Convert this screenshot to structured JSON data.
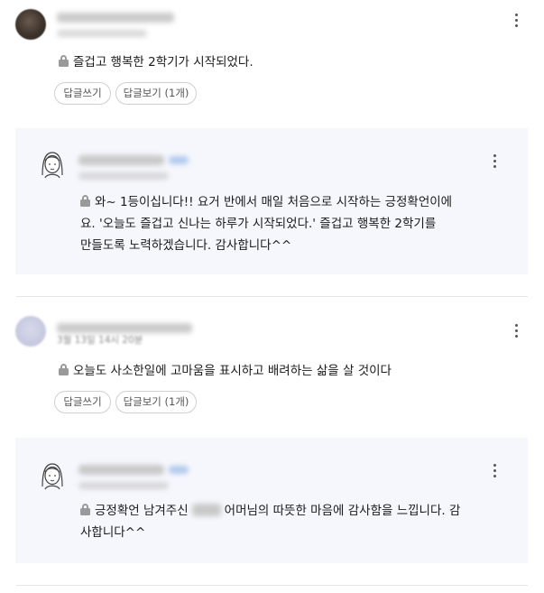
{
  "comment1": {
    "text": "즐겁고 행복한 2학기가 시작되었다.",
    "buttons": {
      "write_reply": "답글쓰기",
      "view_replies": "답글보기 (1개)"
    }
  },
  "reply1": {
    "line1": "와~ 1등이십니다!! 요거 반에서 매일 처음으로 시작하는 긍정확언이에",
    "line2": "요. '오늘도 즐겁고 신나는 하루가 시작되었다.' 즐겁고 행복한 2학기를",
    "line3": "만들도록 노력하겠습니다. 감사합니다^^"
  },
  "comment2": {
    "meta_partial": "3월 13일 14시 20분",
    "text": "오늘도 사소한일에 고마움을 표시하고 배려하는 삶을 살 것이다",
    "buttons": {
      "write_reply": "답글쓰기",
      "view_replies": "답글보기 (1개)"
    }
  },
  "reply2": {
    "line1_before": "긍정확언 남겨주신",
    "line1_after": "어머님의 따뜻한 마음에 감사함을 느낍니다. 감",
    "line2": "사합니다^^"
  },
  "icons": {
    "lock": "lock-icon",
    "more": "more-vertical-icon",
    "teacher_avatar": "teacher-face-icon"
  }
}
